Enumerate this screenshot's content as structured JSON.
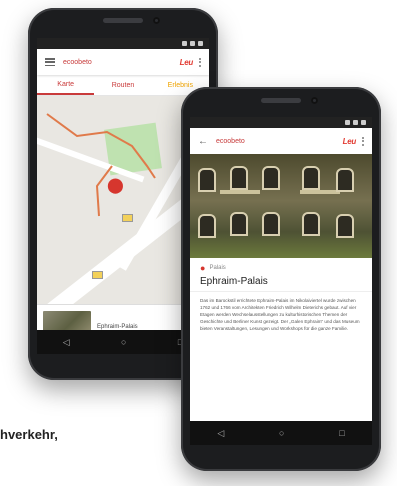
{
  "map_app": {
    "title": "ecoobeto",
    "logo": "Leu",
    "tabs": [
      "Karte",
      "Routen",
      "Erlebnis"
    ],
    "list_item_label": "Ephraim-Palais"
  },
  "detail_app": {
    "title": "ecoobeto",
    "logo": "Leu",
    "category": "Palais",
    "place_title": "Ephraim-Palais",
    "description": "Das im Barockstil errichtete Ephraim-Palais im Nikolaiviertel wurde zwischen 1762 und 1766 vom Architekten Friedrich Wilhelm Dieterichs gebaut. Auf vier Etagen werden Wechselausstellungen zu kulturhistorischen Themen der Geschichte und Berliner Kunst gezeigt. Der „Galen Ephraim“ und das Museum bieten Veranstaltungen, Lesungen und Workshops für die ganze Familie."
  },
  "nav": {
    "back": "◁",
    "home": "○",
    "recent": "□"
  },
  "caption": "hverkehr,",
  "colors": {
    "brand": "#c93b3b",
    "orange_tab": "#f0a400",
    "park": "#bfe2b0",
    "route": "#e07a4a"
  }
}
